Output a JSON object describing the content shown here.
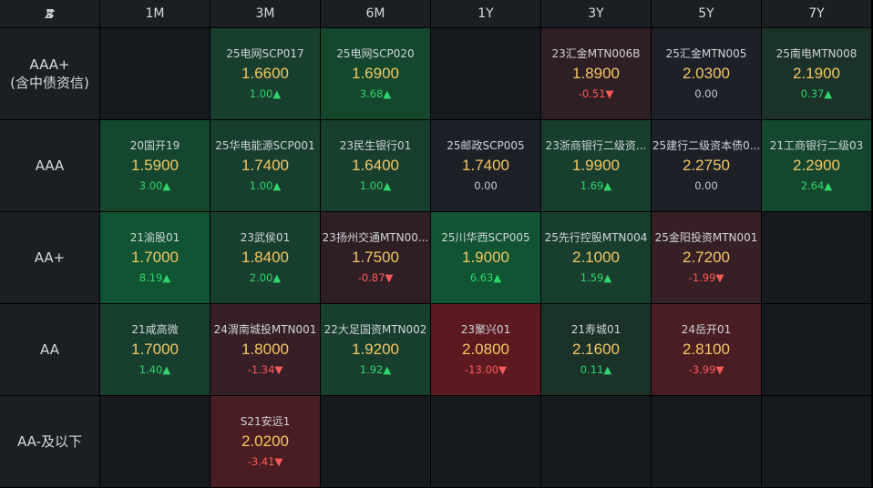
{
  "columns": [
    "1M",
    "3M",
    "6M",
    "1Y",
    "3Y",
    "5Y",
    "7Y"
  ],
  "rows": [
    {
      "label": "AAA+\n(含中债资信)",
      "cells": [
        null,
        {
          "name": "25电网SCP017",
          "yield": "1.6600",
          "change": "1.00▲",
          "dir": "up"
        },
        {
          "name": "25电网SCP020",
          "yield": "1.6900",
          "change": "3.68▲",
          "dir": "up"
        },
        null,
        {
          "name": "23汇金MTN006B",
          "yield": "1.8900",
          "change": "-0.51▼",
          "dir": "down"
        },
        {
          "name": "25汇金MTN005",
          "yield": "2.0300",
          "change": "0.00",
          "dir": "flat"
        },
        {
          "name": "25南电MTN008",
          "yield": "2.1900",
          "change": "0.37▲",
          "dir": "up"
        }
      ]
    },
    {
      "label": "AAA",
      "cells": [
        {
          "name": "20国开19",
          "yield": "1.5900",
          "change": "3.00▲",
          "dir": "up"
        },
        {
          "name": "25华电能源SCP001",
          "yield": "1.7400",
          "change": "1.00▲",
          "dir": "up"
        },
        {
          "name": "23民生银行01",
          "yield": "1.6400",
          "change": "1.00▲",
          "dir": "up"
        },
        {
          "name": "25邮政SCP005",
          "yield": "1.7400",
          "change": "0.00",
          "dir": "flat"
        },
        {
          "name": "23浙商银行二级资...",
          "yield": "1.9900",
          "change": "1.69▲",
          "dir": "up"
        },
        {
          "name": "25建行二级资本债0...",
          "yield": "2.2750",
          "change": "0.00",
          "dir": "flat"
        },
        {
          "name": "21工商银行二级03",
          "yield": "2.2900",
          "change": "2.64▲",
          "dir": "up"
        }
      ]
    },
    {
      "label": "AA+",
      "cells": [
        {
          "name": "21渝股01",
          "yield": "1.7000",
          "change": "8.19▲",
          "dir": "up"
        },
        {
          "name": "23武侯01",
          "yield": "1.8400",
          "change": "2.00▲",
          "dir": "up"
        },
        {
          "name": "23扬州交通MTN00...",
          "yield": "1.7500",
          "change": "-0.87▼",
          "dir": "down"
        },
        {
          "name": "25川华西SCP005",
          "yield": "1.9000",
          "change": "6.63▲",
          "dir": "up"
        },
        {
          "name": "25先行控股MTN004",
          "yield": "2.1000",
          "change": "1.59▲",
          "dir": "up"
        },
        {
          "name": "25金阳投资MTN001",
          "yield": "2.7200",
          "change": "-1.99▼",
          "dir": "down"
        },
        null
      ]
    },
    {
      "label": "AA",
      "cells": [
        {
          "name": "21咸高微",
          "yield": "1.7000",
          "change": "1.40▲",
          "dir": "up"
        },
        {
          "name": "24渭南城投MTN001",
          "yield": "1.8000",
          "change": "-1.34▼",
          "dir": "down"
        },
        {
          "name": "22大足国资MTN002",
          "yield": "1.9200",
          "change": "1.92▲",
          "dir": "up"
        },
        {
          "name": "23聚兴01",
          "yield": "2.0800",
          "change": "-13.00▼",
          "dir": "down"
        },
        {
          "name": "21寿城01",
          "yield": "2.1600",
          "change": "0.11▲",
          "dir": "up"
        },
        {
          "name": "24岳开01",
          "yield": "2.8100",
          "change": "-3.99▼",
          "dir": "down"
        },
        null
      ]
    },
    {
      "label": "AA-及以下",
      "cells": [
        null,
        {
          "name": "S21安远1",
          "yield": "2.0200",
          "change": "-3.41▼",
          "dir": "down"
        },
        null,
        null,
        null,
        null,
        null
      ]
    }
  ]
}
